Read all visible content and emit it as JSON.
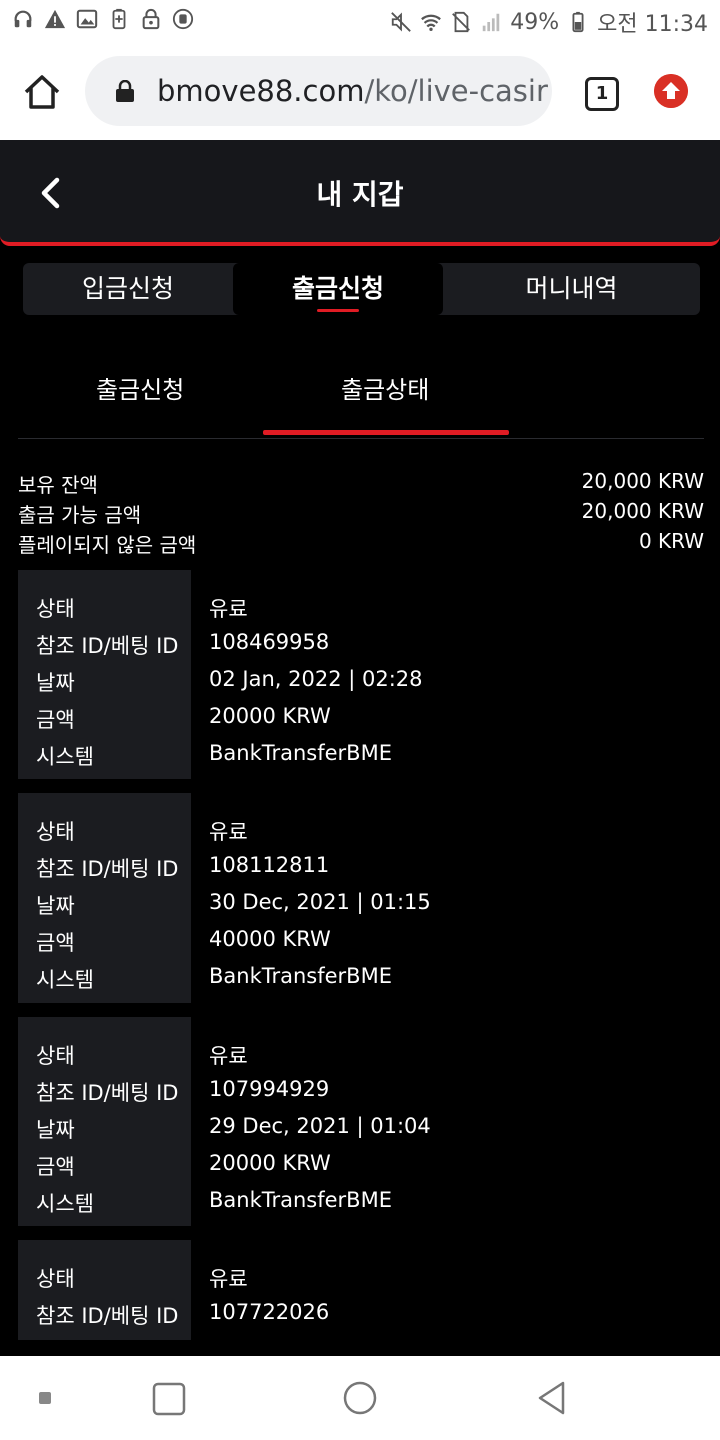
{
  "status_bar": {
    "battery": "49%",
    "time": "오전 11:34",
    "icons": [
      "headphones-icon",
      "warning-icon",
      "image-icon",
      "battery-saver-icon",
      "lock-icon",
      "vpn-icon",
      "mute-icon",
      "wifi-icon",
      "no-sim-icon",
      "signal-icon",
      "battery-icon"
    ]
  },
  "browser": {
    "url_host": "bmove88.com",
    "url_path": "/ko/live-casir",
    "tab_count": "1"
  },
  "header": {
    "title": "내 지갑"
  },
  "tabs": [
    {
      "label": "입금신청",
      "active": false
    },
    {
      "label": "출금신청",
      "active": true
    },
    {
      "label": "머니내역",
      "active": false
    }
  ],
  "subtabs": [
    {
      "label": "출금신청",
      "active": false
    },
    {
      "label": "출금상태",
      "active": true
    }
  ],
  "balances": [
    {
      "label": "보유 잔액",
      "value": "20,000 KRW"
    },
    {
      "label": "출금 가능 금액",
      "value": "20,000 KRW"
    },
    {
      "label": "플레이되지 않은 금액",
      "value": "0 KRW"
    }
  ],
  "field_labels": {
    "status": "상태",
    "ref": "참조 ID/베팅 ID",
    "date": "날짜",
    "amount": "금액",
    "system": "시스템"
  },
  "records": [
    {
      "status": "유료",
      "ref": "108469958",
      "date": "02 Jan, 2022 | 02:28",
      "amount": "20000 KRW",
      "system": "BankTransferBME"
    },
    {
      "status": "유료",
      "ref": "108112811",
      "date": "30 Dec, 2021 | 01:15",
      "amount": "40000 KRW",
      "system": "BankTransferBME"
    },
    {
      "status": "유료",
      "ref": "107994929",
      "date": "29 Dec, 2021 | 01:04",
      "amount": "20000 KRW",
      "system": "BankTransferBME"
    },
    {
      "status": "유료",
      "ref": "107722026"
    }
  ],
  "colors": {
    "accent": "#e01c24",
    "background": "#000000",
    "panel": "#1b1c20"
  }
}
